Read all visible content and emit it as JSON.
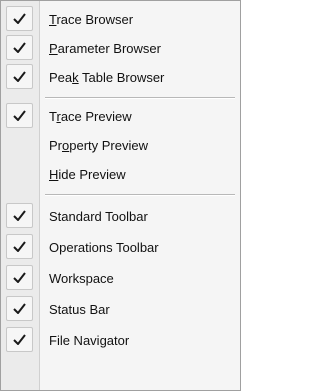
{
  "menu": {
    "items": [
      {
        "label": "Trace Browser",
        "mnemonic": "T",
        "checked": true
      },
      {
        "label": "Parameter Browser",
        "mnemonic": "P",
        "checked": true
      },
      {
        "label": "Peak Table Browser",
        "mnemonic": "k",
        "checked": true
      },
      {
        "label": "Trace Preview",
        "mnemonic": "r",
        "checked": true
      },
      {
        "label": "Property Preview",
        "mnemonic": "o",
        "checked": false
      },
      {
        "label": "Hide Preview",
        "mnemonic": "H",
        "checked": false
      },
      {
        "label": "Standard Toolbar",
        "mnemonic": "",
        "checked": true
      },
      {
        "label": "Operations Toolbar",
        "mnemonic": "",
        "checked": true
      },
      {
        "label": "Workspace",
        "mnemonic": "",
        "checked": true
      },
      {
        "label": "Status Bar",
        "mnemonic": "",
        "checked": true
      },
      {
        "label": "File Navigator",
        "mnemonic": "",
        "checked": true
      }
    ]
  },
  "colors": {
    "menu_bg": "#f5f5f5",
    "gutter_bg": "#ebebeb",
    "check": "#1a1a1a"
  },
  "icons": {
    "check": "checkmark-icon"
  }
}
